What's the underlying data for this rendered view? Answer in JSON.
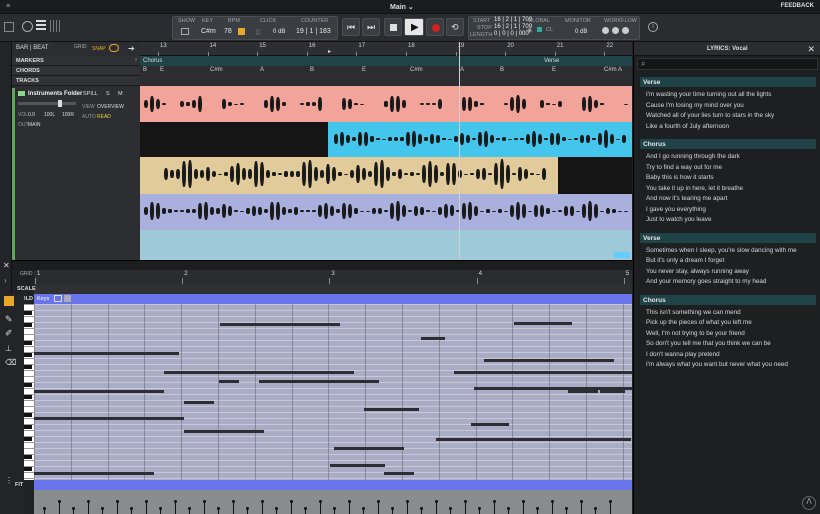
{
  "window": {
    "title": "Main ⌄",
    "feedback": "FEEDBACK"
  },
  "transport": {
    "show": "SHOW",
    "key": "KEY",
    "bpm": "BPM",
    "click": "CLICK",
    "counter": "COUNTER",
    "key_value": "C#m",
    "bpm_value": "78",
    "click_value": "0 dB",
    "counter_value": "19 | 1 | 183",
    "start_label": "START",
    "stop_label": "STOP",
    "length_label": "LENGTH",
    "start_value": "16 | 2 | 1 | 709",
    "stop_value": "16 | 2 | 1 | 709",
    "length_value": "0 | 0 | 0 | 000",
    "global": "GLOBAL",
    "monitor": "MONITOR",
    "workflow": "WORKFLOW",
    "cl": "CL",
    "monitor_value": "0 dB"
  },
  "track_header": {
    "bar_beat": "BAR | BEAT",
    "grid": "GRID",
    "snap": "SNAP",
    "markers": "MARKERS",
    "chords": "CHORDS",
    "tracks": "TRACKS",
    "folder_name": "Instruments Folder",
    "spill": "SPILL",
    "s": "S",
    "m": "M",
    "vol": "VOL",
    "vol_value": "0.0",
    "pan_l": "100L",
    "pan_r": "100R",
    "out": "OUT",
    "out_value": "MAIN",
    "view": "VIEW",
    "view_value": "OVERVIEW",
    "auto": "AUTO",
    "auto_value": "READ"
  },
  "ruler": {
    "bars": [
      "13",
      "14",
      "15",
      "16",
      "17",
      "18",
      "19",
      "20",
      "21",
      "22"
    ]
  },
  "markers": {
    "chorus": "Chorus",
    "verse": "Verse"
  },
  "chords": [
    "B",
    "E",
    "C#m",
    "A",
    "B",
    "E",
    "C#m",
    "A",
    "B",
    "E",
    "C#m",
    "A"
  ],
  "editor": {
    "grid": "GRID",
    "scale": "SCALE",
    "fold": "FOLD",
    "keys": "Keys",
    "fit": "FIT",
    "bars": [
      "1",
      "2",
      "3",
      "4",
      "5"
    ]
  },
  "lyrics": {
    "title": "LYRICS: Vocal",
    "sections": [
      {
        "name": "Verse",
        "lines": [
          "I'm wasting your time turning out all the lights",
          "Cause I'm losing my mind over you",
          "Watched all of your lies turn to stars in the sky",
          "Like a fourth of July afternoon"
        ]
      },
      {
        "name": "Chorus",
        "lines": [
          "And I go running through the dark",
          "Try to find a way out for me",
          "Baby this is how it starts",
          "You take it up in here, let it breathe",
          "And now it's tearing me apart",
          "I gave you everything",
          "Just to watch you leave"
        ]
      },
      {
        "name": "Verse",
        "lines": [
          "Sometimes when I sleep, you're slow dancing with me",
          "But it's only a dream I forget",
          "You never stay, always running away",
          "And your memory goes straight to my head"
        ]
      },
      {
        "name": "Chorus",
        "lines": [
          "This isn't something we can mend",
          "Pick up the pieces of what you left me",
          "Well, I'm not trying to be your friend",
          "So don't you tell me that you think we can be",
          "I don't wanna play pretend",
          "I'm always what you want but never what you need"
        ]
      }
    ]
  },
  "colors": {
    "track1": "#f2a39a",
    "track2": "#44c6ec",
    "track3": "#e1cb9a",
    "track4": "#a9b0dd",
    "track5": "#9dc9d8",
    "accent": "#6a74ea"
  }
}
